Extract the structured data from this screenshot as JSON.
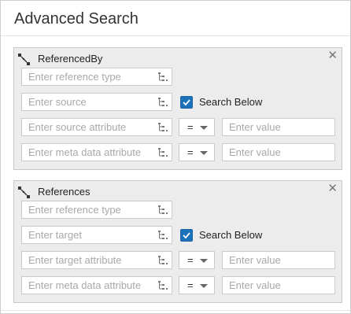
{
  "dialog": {
    "title": "Advanced Search"
  },
  "groups": [
    {
      "title": "ReferencedBy",
      "close": "✕",
      "reference_type": {
        "placeholder": "Enter reference type",
        "value": ""
      },
      "endpoint": {
        "placeholder": "Enter source",
        "value": ""
      },
      "search_below": {
        "label": "Search Below",
        "checked": true
      },
      "attribute": {
        "placeholder": "Enter source attribute",
        "value": ""
      },
      "attribute_op": "=",
      "attribute_value": {
        "placeholder": "Enter value",
        "value": ""
      },
      "meta_attribute": {
        "placeholder": "Enter meta data attribute",
        "value": ""
      },
      "meta_op": "=",
      "meta_value": {
        "placeholder": "Enter value",
        "value": ""
      }
    },
    {
      "title": "References",
      "close": "✕",
      "reference_type": {
        "placeholder": "Enter reference type",
        "value": ""
      },
      "endpoint": {
        "placeholder": "Enter target",
        "value": ""
      },
      "search_below": {
        "label": "Search Below",
        "checked": true
      },
      "attribute": {
        "placeholder": "Enter target attribute",
        "value": ""
      },
      "attribute_op": "=",
      "attribute_value": {
        "placeholder": "Enter value",
        "value": ""
      },
      "meta_attribute": {
        "placeholder": "Enter meta data attribute",
        "value": ""
      },
      "meta_op": "=",
      "meta_value": {
        "placeholder": "Enter value",
        "value": ""
      }
    }
  ],
  "icons": {
    "group": "reference-link-icon",
    "picker": "tree-picker-icon",
    "close": "close-icon",
    "checkbox": "checkmark-icon",
    "dropdown": "caret-down-icon"
  },
  "colors": {
    "checkbox": "#1c71b8",
    "panel": "#ececec"
  }
}
